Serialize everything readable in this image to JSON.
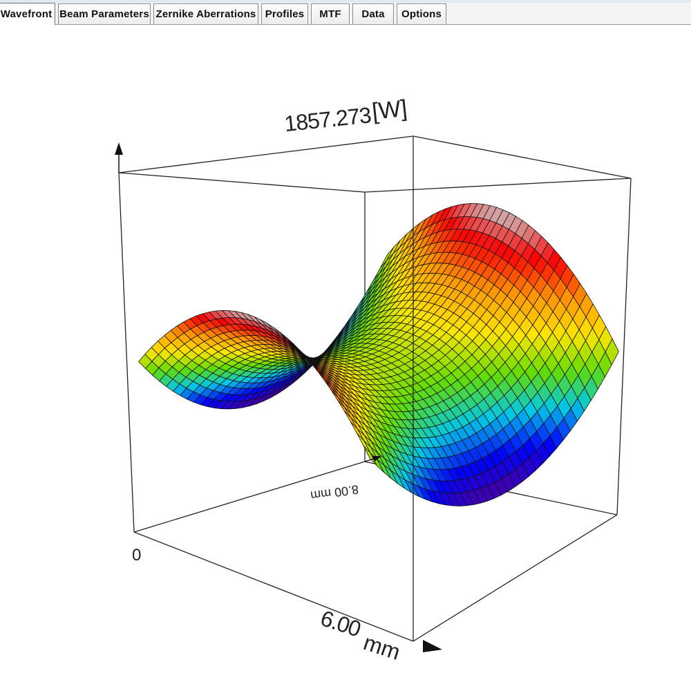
{
  "tabs": [
    {
      "label": "Wavefront",
      "active": true
    },
    {
      "label": "Beam Parameters",
      "active": false
    },
    {
      "label": "Zernike Aberrations",
      "active": false
    },
    {
      "label": "Profiles",
      "active": false
    },
    {
      "label": "MTF",
      "active": false
    },
    {
      "label": "Data",
      "active": false
    },
    {
      "label": "Options",
      "active": false
    }
  ],
  "plot": {
    "z_max_label": "1857.273",
    "z_unit_label": "[W]",
    "x_min_label": "0",
    "x_max_label": "6.00",
    "x_unit_label": "mm",
    "y_max_label": "8.00 mm"
  },
  "chart_data": {
    "type": "surface",
    "surface": "saddle (astigmatic wavefront)",
    "z_max": 1857.273,
    "z_unit": "W",
    "x_range": [
      0,
      6.0
    ],
    "x_unit": "mm",
    "y_range": [
      0,
      8.0
    ],
    "y_unit": "mm",
    "colormap": [
      "#4b00a0",
      "#0000ff",
      "#00c8e6",
      "#64dc00",
      "#ffe600",
      "#ff9600",
      "#ff0000",
      "#c8c8c8"
    ]
  }
}
